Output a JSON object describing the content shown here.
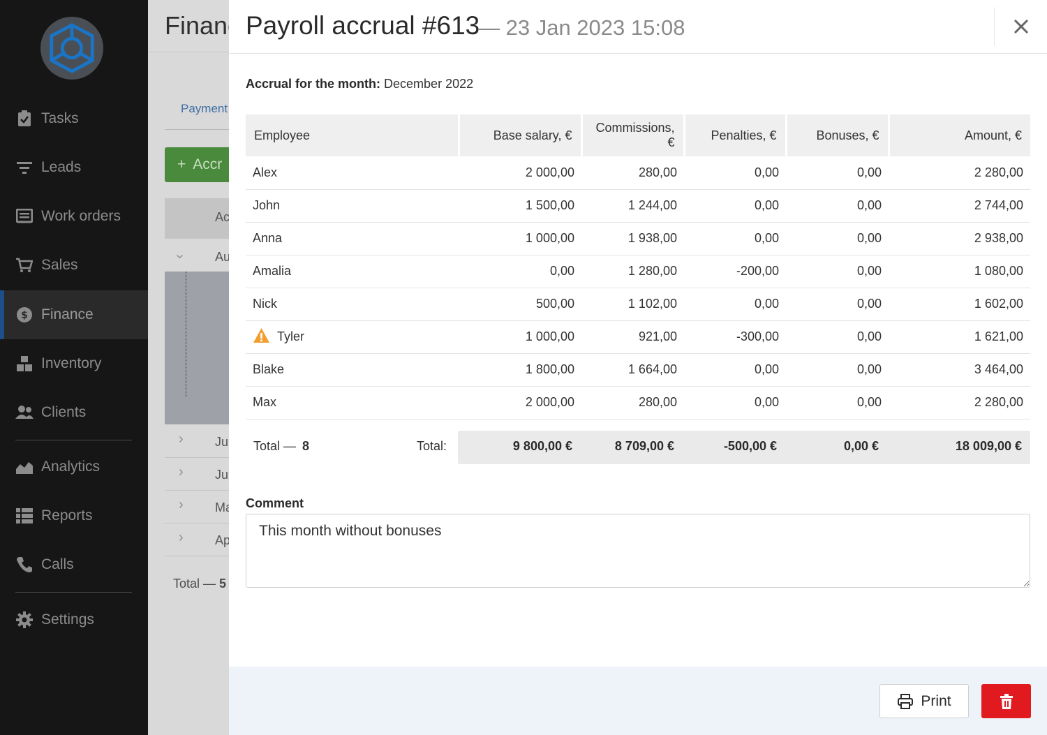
{
  "sidebar": {
    "items": [
      {
        "label": "Tasks",
        "icon": "clipboard-check-icon"
      },
      {
        "label": "Leads",
        "icon": "filter-icon"
      },
      {
        "label": "Work orders",
        "icon": "document-icon"
      },
      {
        "label": "Sales",
        "icon": "cart-icon"
      },
      {
        "label": "Finance",
        "icon": "dollar-icon",
        "active": true
      },
      {
        "label": "Inventory",
        "icon": "boxes-icon"
      },
      {
        "label": "Clients",
        "icon": "users-icon"
      },
      {
        "label": "Analytics",
        "icon": "area-chart-icon"
      },
      {
        "label": "Reports",
        "icon": "list-icon"
      },
      {
        "label": "Calls",
        "icon": "phone-icon"
      },
      {
        "label": "Settings",
        "icon": "gear-icon"
      }
    ]
  },
  "background": {
    "title": "Financ",
    "tab": "Payment",
    "add_button": "Accr",
    "head_cell": "Ac",
    "first_row": "Au",
    "rows": [
      "Jul",
      "Jun",
      "Ma",
      "Ap"
    ],
    "total_label": "Total — ",
    "total_count": "5"
  },
  "modal": {
    "title": "Payroll accrual #613",
    "date": "— 23 Jan 2023 15:08",
    "accrual_label": "Accrual for the month:",
    "accrual_value": "December 2022",
    "columns": [
      "Employee",
      "Base salary, €",
      "Commissions, €",
      "Penalties, €",
      "Bonuses, €",
      "Amount, €"
    ],
    "rows": [
      {
        "employee": "Alex",
        "base": "2 000,00",
        "commissions": "280,00",
        "penalties": "0,00",
        "bonuses": "0,00",
        "amount": "2 280,00",
        "warning": false
      },
      {
        "employee": "John",
        "base": "1 500,00",
        "commissions": "1 244,00",
        "penalties": "0,00",
        "bonuses": "0,00",
        "amount": "2 744,00",
        "warning": false
      },
      {
        "employee": "Anna",
        "base": "1 000,00",
        "commissions": "1 938,00",
        "penalties": "0,00",
        "bonuses": "0,00",
        "amount": "2 938,00",
        "warning": false
      },
      {
        "employee": "Amalia",
        "base": "0,00",
        "commissions": "1 280,00",
        "penalties": "-200,00",
        "bonuses": "0,00",
        "amount": "1 080,00",
        "warning": false
      },
      {
        "employee": "Nick",
        "base": "500,00",
        "commissions": "1 102,00",
        "penalties": "0,00",
        "bonuses": "0,00",
        "amount": "1 602,00",
        "warning": false
      },
      {
        "employee": "Tyler",
        "base": "1 000,00",
        "commissions": "921,00",
        "penalties": "-300,00",
        "bonuses": "0,00",
        "amount": "1 621,00",
        "warning": true
      },
      {
        "employee": "Blake",
        "base": "1 800,00",
        "commissions": "1 664,00",
        "penalties": "0,00",
        "bonuses": "0,00",
        "amount": "3 464,00",
        "warning": false
      },
      {
        "employee": "Max",
        "base": "2 000,00",
        "commissions": "280,00",
        "penalties": "0,00",
        "bonuses": "0,00",
        "amount": "2 280,00",
        "warning": false
      }
    ],
    "total": {
      "count_label": "Total —",
      "count": "8",
      "label": "Total:",
      "base": "9 800,00 €",
      "commissions": "8 709,00 €",
      "penalties": "-500,00 €",
      "bonuses": "0,00 €",
      "amount": "18 009,00 €"
    },
    "comment_label": "Comment",
    "comment_value": "This month without bonuses",
    "print_label": "Print"
  },
  "colors": {
    "sidebar_bg": "#161616",
    "accent_blue": "#1e4f8a",
    "delete_red": "#e11a1f",
    "warning_orange": "#f0a030",
    "footer_bg": "#eef3f9"
  }
}
